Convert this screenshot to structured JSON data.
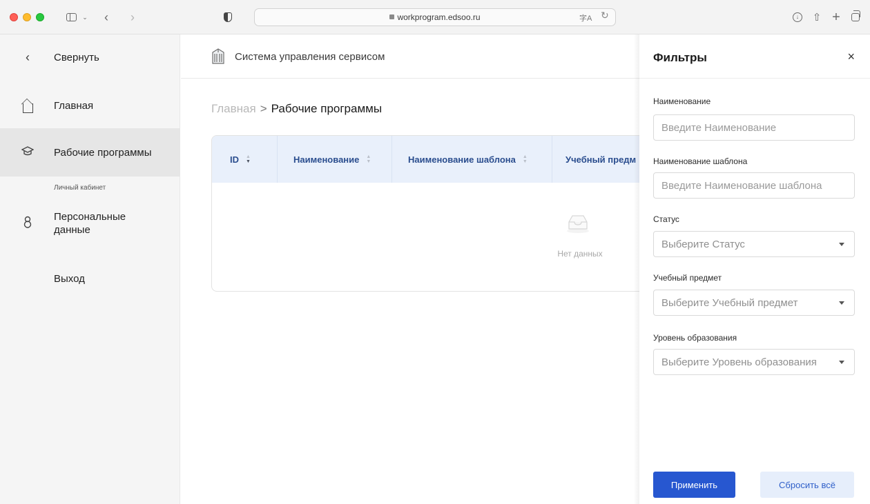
{
  "browser": {
    "url": "workprogram.edsoo.ru",
    "translate_glyph": "字A",
    "reload_glyph": "↻",
    "back_glyph": "‹",
    "forward_glyph": "›"
  },
  "sidebar": {
    "collapse_label": "Свернуть",
    "items": [
      {
        "label": "Главная",
        "icon": "home-icon"
      },
      {
        "label": "Рабочие программы",
        "icon": "graduation-cap-icon",
        "active": true
      }
    ],
    "section_title": "Личный кабинет",
    "personal_label": "Персональные данные",
    "exit_label": "Выход"
  },
  "header": {
    "app_title": "Система управления сервисом"
  },
  "breadcrumb": {
    "home": "Главная",
    "separator": ">",
    "current": "Рабочие программы"
  },
  "table": {
    "columns": [
      "ID",
      "Наименование",
      "Наименование шаблона",
      "Учебный предм"
    ],
    "empty_text": "Нет данных"
  },
  "filters": {
    "title": "Фильтры",
    "close_glyph": "×",
    "name_label": "Наименование",
    "name_placeholder": "Введите Наименование",
    "template_label": "Наименование шаблона",
    "template_placeholder": "Введите Наименование шаблона",
    "status_label": "Статус",
    "status_placeholder": "Выберите Статус",
    "subject_label": "Учебный предмет",
    "subject_placeholder": "Выберите Учебный предмет",
    "level_label": "Уровень образования",
    "level_placeholder": "Выберите Уровень образования",
    "apply_label": "Применить",
    "reset_label": "Сбросить всё"
  },
  "colors": {
    "primary": "#2757d0",
    "table_header_bg": "#e9f0fb",
    "table_header_text": "#2a4d8e",
    "sidebar_bg": "#f5f5f5",
    "sidebar_active_bg": "#e6e6e6"
  }
}
